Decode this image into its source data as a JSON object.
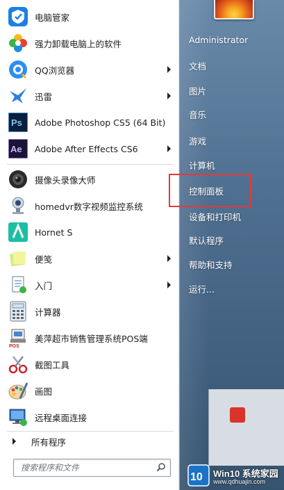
{
  "programs": [
    {
      "label": "电脑管家",
      "icon": "tencent-pc-manager-icon",
      "submenu": false
    },
    {
      "label": "强力卸载电脑上的软件",
      "icon": "uninstall-flower-icon",
      "submenu": false
    },
    {
      "label": "QQ浏览器",
      "icon": "qq-browser-icon",
      "submenu": true
    },
    {
      "label": "迅雷",
      "icon": "thunder-bird-icon",
      "submenu": true
    },
    {
      "label": "Adobe Photoshop CS5 (64 Bit)",
      "icon": "photoshop-icon",
      "submenu": false
    },
    {
      "label": "Adobe After Effects CS6",
      "icon": "after-effects-icon",
      "submenu": true
    },
    {
      "label": "摄像头录像大师",
      "icon": "webcam-recorder-icon",
      "submenu": false
    },
    {
      "label": "homedvr数字视频监控系统",
      "icon": "homedvr-camera-icon",
      "submenu": false
    },
    {
      "label": "Hornet S",
      "icon": "hornet-icon",
      "submenu": false
    },
    {
      "label": "便笺",
      "icon": "sticky-notes-icon",
      "submenu": true
    },
    {
      "label": "入门",
      "icon": "getting-started-icon",
      "submenu": true
    },
    {
      "label": "计算器",
      "icon": "calculator-icon",
      "submenu": false
    },
    {
      "label": "美萍超市销售管理系统POS端",
      "icon": "pos-system-icon",
      "submenu": false
    },
    {
      "label": "截图工具",
      "icon": "snipping-tool-icon",
      "submenu": false
    },
    {
      "label": "画图",
      "icon": "paint-icon",
      "submenu": false
    },
    {
      "label": "远程桌面连接",
      "icon": "remote-desktop-icon",
      "submenu": false
    }
  ],
  "all_programs_label": "所有程序",
  "search": {
    "placeholder": "搜索程序和文件"
  },
  "right_pane": {
    "items": [
      "Administrator",
      "文档",
      "图片",
      "音乐",
      "游戏",
      "计算机",
      "控制面板",
      "设备和打印机",
      "默认程序",
      "帮助和支持",
      "运行..."
    ],
    "highlighted": "控制面板"
  },
  "watermark": {
    "logo_text": "10",
    "title": "Win10 系统家园",
    "url": "www.qdhuajin.com"
  },
  "colors": {
    "highlight": "#e23a3a",
    "right_pane": "#4f6f90"
  }
}
